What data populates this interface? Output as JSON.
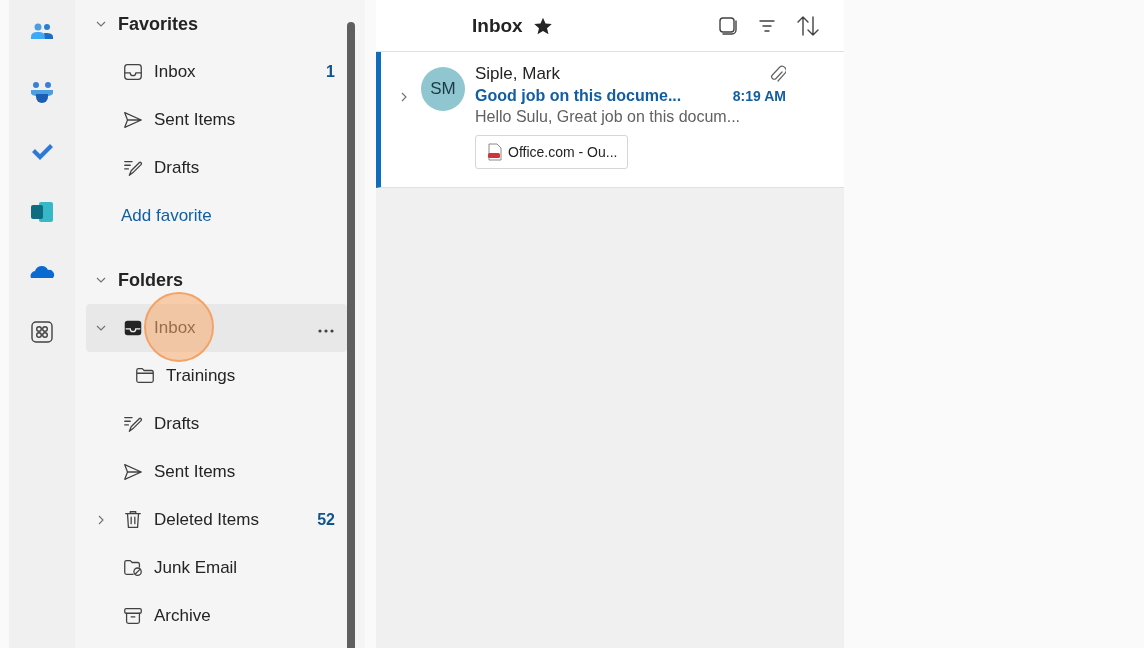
{
  "favorites": {
    "title": "Favorites",
    "expanded": true,
    "items": [
      {
        "kind": "inbox",
        "label": "Inbox",
        "count": "1",
        "selected": false
      },
      {
        "kind": "sent",
        "label": "Sent Items",
        "selected": false
      },
      {
        "kind": "drafts",
        "label": "Drafts",
        "selected": false
      },
      {
        "kind": "add",
        "label": "Add favorite",
        "selected": false
      }
    ]
  },
  "folders": {
    "title": "Folders",
    "expanded": true,
    "items": [
      {
        "kind": "inbox",
        "label": "Inbox",
        "selected": true,
        "expanded": true,
        "highlighted": true,
        "children": [
          {
            "kind": "folder",
            "label": "Trainings",
            "selected": false
          }
        ]
      },
      {
        "kind": "drafts",
        "label": "Drafts",
        "selected": false
      },
      {
        "kind": "sent",
        "label": "Sent Items",
        "selected": false
      },
      {
        "kind": "deleted",
        "label": "Deleted Items",
        "count": "52",
        "selected": false,
        "expanded": false
      },
      {
        "kind": "junk",
        "label": "Junk Email",
        "selected": false
      },
      {
        "kind": "archive",
        "label": "Archive",
        "selected": false
      }
    ]
  },
  "message_list": {
    "title": "Inbox",
    "favorite": true,
    "messages": [
      {
        "sender": "Siple, Mark",
        "initials": "SM",
        "subject": "Good job on this docume...",
        "time": "8:19 AM",
        "preview": "Hello Sulu, Great job on this docum...",
        "attachment": "Office.com - Ou...",
        "unread": true,
        "expanded": false
      }
    ]
  }
}
